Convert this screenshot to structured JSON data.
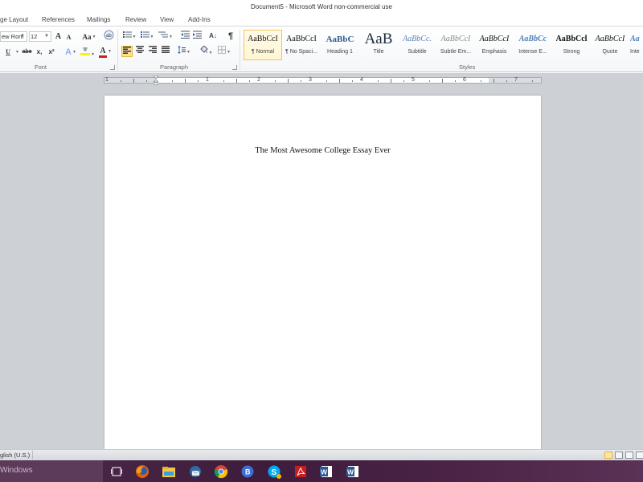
{
  "window": {
    "title": "Document5  -  Microsoft Word non-commercial use"
  },
  "tabs": [
    {
      "label": "ge Layout"
    },
    {
      "label": "References"
    },
    {
      "label": "Mailings"
    },
    {
      "label": "Review"
    },
    {
      "label": "View"
    },
    {
      "label": "Add-Ins"
    }
  ],
  "ribbon": {
    "font": {
      "group_label": "Font",
      "font_name": "ew Rom",
      "font_size": "12",
      "grow_font": "A",
      "shrink_font": "A",
      "change_case": "Aa",
      "underline": "U",
      "strikethrough": "abe",
      "subscript": "x,",
      "superscript": "x²",
      "text_effects": "A",
      "font_color": "A",
      "highlight_color": "#ffff00",
      "font_color_value": "#d11f1f"
    },
    "paragraph": {
      "group_label": "Paragraph",
      "sort": "A↓",
      "show_marks": "¶"
    },
    "styles": {
      "group_label": "Styles",
      "items": [
        {
          "preview": "AaBbCcI",
          "name": "¶ Normal",
          "selected": true
        },
        {
          "preview": "AaBbCcI",
          "name": "¶ No Spaci..."
        },
        {
          "preview": "AaBbC",
          "name": "Heading 1"
        },
        {
          "preview": "AaB",
          "name": "Title"
        },
        {
          "preview": "AaBbCc.",
          "name": "Subtitle"
        },
        {
          "preview": "AaBbCcI",
          "name": "Subtle Em..."
        },
        {
          "preview": "AaBbCcI",
          "name": "Emphasis"
        },
        {
          "preview": "AaBbCc",
          "name": "Intense E..."
        },
        {
          "preview": "AaBbCcl",
          "name": "Strong"
        },
        {
          "preview": "AaBbCcI",
          "name": "Quote"
        },
        {
          "preview": "Aa",
          "name": "Inte"
        }
      ]
    }
  },
  "ruler": {
    "numbers": [
      "1",
      "1",
      "2",
      "3",
      "4",
      "5",
      "6",
      "7"
    ]
  },
  "document": {
    "title_text": "The Most Awesome College Essay Ever"
  },
  "statusbar": {
    "language": "glish (U.S.)"
  },
  "taskbar": {
    "search_text": "Windows",
    "apps": [
      {
        "name": "task-view"
      },
      {
        "name": "firefox"
      },
      {
        "name": "file-explorer"
      },
      {
        "name": "thunderbird"
      },
      {
        "name": "chrome"
      },
      {
        "name": "blue-app"
      },
      {
        "name": "skype"
      },
      {
        "name": "acrobat"
      },
      {
        "name": "word-1"
      },
      {
        "name": "word-2"
      }
    ]
  },
  "colors": {
    "accent_selected": "#f2c25a",
    "taskbar": "#4d2a4c",
    "workspace": "#cdd0d5"
  }
}
